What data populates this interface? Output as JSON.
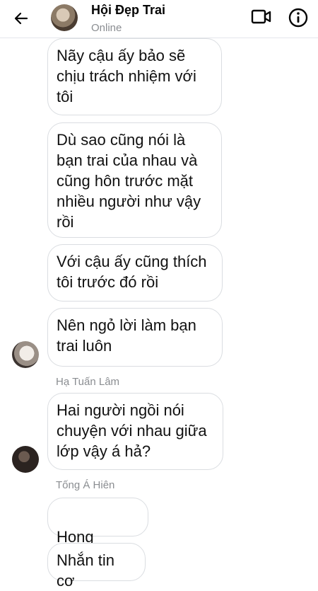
{
  "header": {
    "title": "Hội Đẹp Trai",
    "status": "Online"
  },
  "messages": [
    {
      "text": "Nãy cậu ấy bảo sẽ\nchịu trách nhiệm với\ntôi"
    },
    {
      "text": "Dù sao cũng nói là\nbạn trai của nhau và\ncũng hôn trước mặt\nnhiều người như vậy\nrồi"
    },
    {
      "text": "Với cậu ấy cũng thích\ntôi trước đó rồi"
    },
    {
      "text": "Nên ngỏ lời làm bạn\ntrai luôn"
    },
    {
      "sender": "Hạ Tuấn Lâm",
      "text": "Hai người ngồi nói\nchuyện với nhau giữa\nlớp vậy á hả?"
    },
    {
      "sender": "Tống Á Hiên",
      "text": "Hong"
    },
    {
      "text": "Nhắn tin cơ"
    }
  ],
  "icons": {
    "back": "arrow-left",
    "video": "video-camera",
    "info": "info-circle",
    "emoji": "pointing-hands"
  },
  "colors": {
    "bubble_border": "#dadde1",
    "muted_text": "#8a8d91",
    "emoji": "#f5b82e"
  }
}
